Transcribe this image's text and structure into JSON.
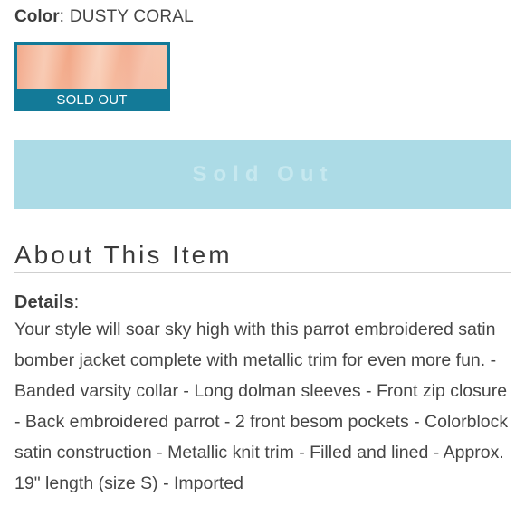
{
  "color_selector": {
    "label": "Color",
    "separator": ":",
    "value": "DUSTY CORAL"
  },
  "swatch": {
    "name": "DUSTY CORAL",
    "status_label": "SOLD OUT",
    "swatch_color": "#f4b394",
    "border_color": "#137a98"
  },
  "purchase": {
    "button_label": "Sold Out",
    "button_color": "#acdbe6"
  },
  "about": {
    "title": "About This Item"
  },
  "details": {
    "label": "Details",
    "separator": ":",
    "text": "Your style will soar sky high with this parrot embroidered satin bomber jacket complete with metallic trim for even more fun. - Banded varsity collar - Long dolman sleeves - Front zip closure - Back embroidered parrot - 2 front besom pockets - Colorblock satin construction - Metallic knit trim - Filled and lined - Approx. 19\" length (size S) - Imported"
  }
}
